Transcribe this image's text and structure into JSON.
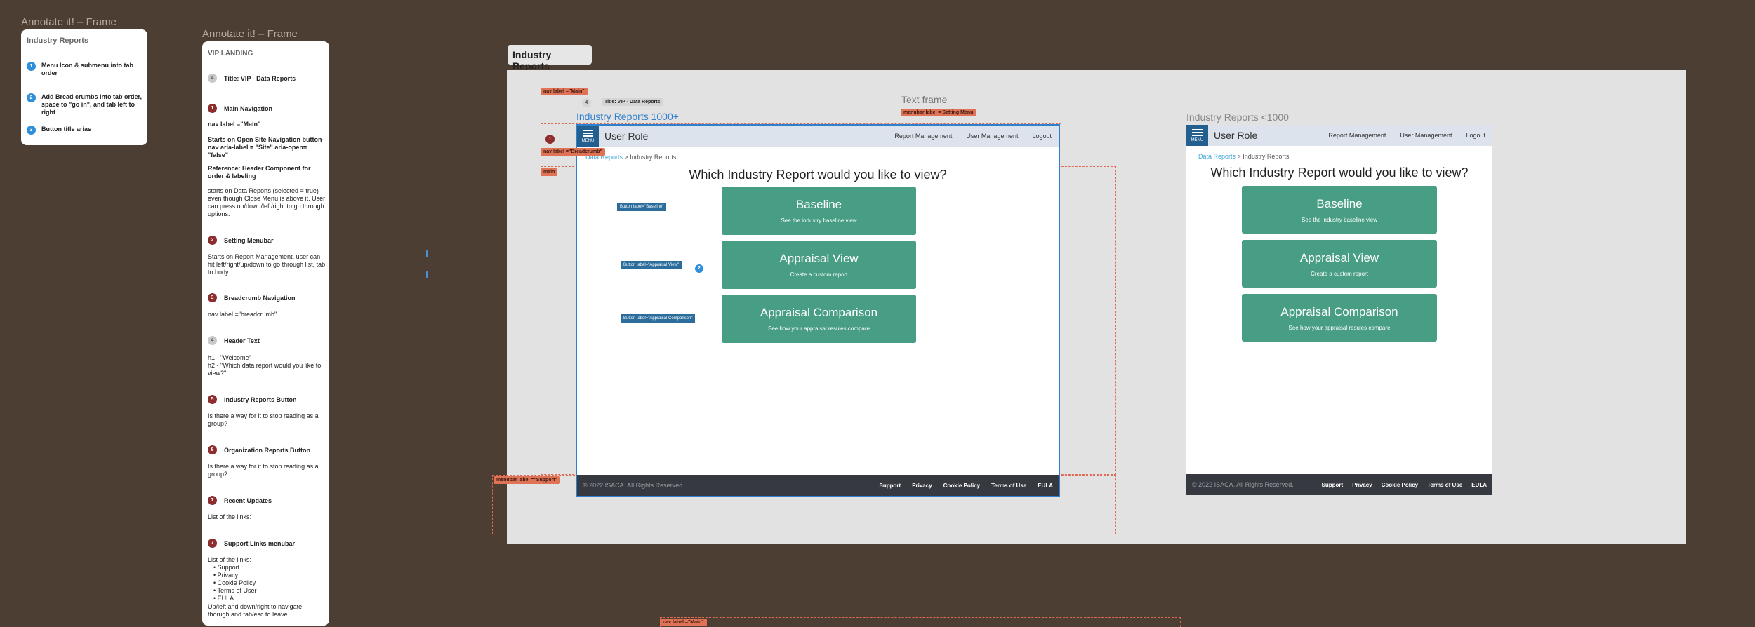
{
  "frame1": {
    "label": "Annotate it! – Frame",
    "title": "Industry Reports",
    "items": [
      {
        "num": "1",
        "text": "Menu Icon & submenu into tab order"
      },
      {
        "num": "2",
        "text": "Add Bread crumbs into tab order, space to \"go in\", and tab left to right"
      },
      {
        "num": "3",
        "text": "Button title arias"
      }
    ]
  },
  "frame2": {
    "label": "Annotate it! – Frame",
    "title": "VIP LANDING",
    "notes": [
      {
        "num": "4",
        "title": "Title: VIP - Data Reports"
      },
      {
        "num": "1",
        "title": "Main Navigation"
      },
      {
        "num": "2",
        "title": "Setting Menubar"
      },
      {
        "num": "3",
        "title": "Breadcrumb Navigation"
      },
      {
        "num": "4",
        "title": "Header Text"
      },
      {
        "num": "5",
        "title": "Industry Reports Button"
      },
      {
        "num": "6",
        "title": "Organization Reports Button"
      },
      {
        "num": "7",
        "title": "Recent Updates"
      },
      {
        "num": "7",
        "title": "Support Links menubar"
      }
    ],
    "mainnav_1": "nav label =\"Main\"",
    "mainnav_2": "Starts on Open Site Navigation button- nav aria-label = \"Site\" aria-open= \"false\"",
    "mainnav_3": "Reference: Header Component for order & labeling",
    "mainnav_4": "starts on Data Reports (selected = true) even though Close Menu is above it. User can press up/down/left/right to go through options.",
    "setting_text": "Starts on Report Management, user can hit left/right/up/down to go through list, tab to body",
    "crumb_text": "nav label =\"breadcrumb\"",
    "header_text_1": "h1 - \"Welcome\"",
    "header_text_2": "h2 - \"Which data report would you like to view?\"",
    "industry_text": "Is there a way for it to stop reading as a group?",
    "org_text": "Is there a way for it to stop reading as a group?",
    "recent_text": "List of the links:",
    "support_text": "List of the links:",
    "support_list": [
      "Support",
      "Privacy",
      "Cookie Policy",
      "Terms of User",
      "EULA"
    ],
    "support_tail": "Up/left and down/right to navigate thorugh and tab/esc to leave"
  },
  "page_title": "Industry Reports",
  "annotations": {
    "nav_main": "nav label =\"Main\"",
    "title_tag": "Title: VIP - Data Reports",
    "title_num": "4",
    "text_frame": "Text frame",
    "menubar_setting": "menubar label = Setting Menu",
    "nav_breadcrumb": "nav label =\"Breadcrumb\"",
    "main_tag": "main",
    "menubar_support": "menubar label =\"Support\"",
    "nav_main_bottom": "nav label =\"Main\"",
    "num1": "1",
    "num2": "2",
    "btn_baseline": "Button label=\"Baseline\"",
    "btn_appraisal": "Button label=\"Appraisal View\"",
    "btn_comparison": "Button label=\"Appraisal Comparison\""
  },
  "desktop": {
    "heading": "Industry Reports 1000+"
  },
  "mobile": {
    "heading": "Industry Reports <1000"
  },
  "app": {
    "menu_label": "MENU",
    "role": "User Role",
    "nav_links": [
      "Report Management",
      "User Management",
      "Logout"
    ],
    "crumb_link": "Data Reports",
    "crumb_current": "> Industry Reports",
    "question": "Which Industry Report would you like to view?",
    "cards": [
      {
        "title": "Baseline",
        "sub": "See the industry baseline view"
      },
      {
        "title": "Appraisal View",
        "sub": "Create a custom report"
      },
      {
        "title": "Appraisal Comparison",
        "sub": "See how your appraisal resules compare"
      }
    ],
    "copyright": "© 2022 ISACA. All Rights Reserved.",
    "footer_links": [
      "Support",
      "Privacy",
      "Cookie Policy",
      "Terms of Use",
      "EULA"
    ]
  }
}
